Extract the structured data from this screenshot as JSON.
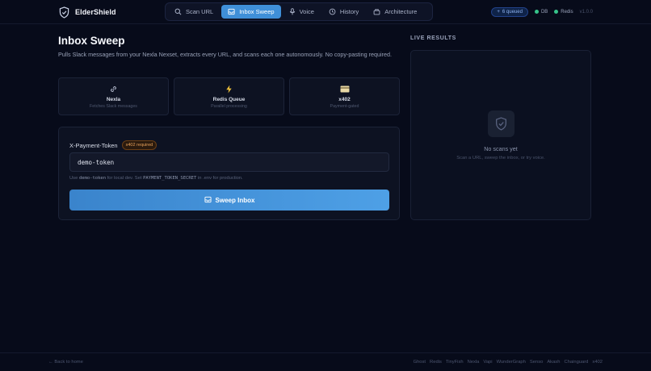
{
  "app": {
    "name": "ElderShield",
    "version": "v1.0.0"
  },
  "nav": {
    "items": [
      {
        "label": "Scan URL",
        "icon": "search-icon"
      },
      {
        "label": "Inbox Sweep",
        "icon": "inbox-icon",
        "active": true
      },
      {
        "label": "Voice",
        "icon": "microphone-icon"
      },
      {
        "label": "History",
        "icon": "clock-icon"
      },
      {
        "label": "Architecture",
        "icon": "stack-icon"
      }
    ]
  },
  "status": {
    "queued": "6 queued",
    "db": "DB",
    "redis": "Redis",
    "dot_color": "#36c48a"
  },
  "main": {
    "title": "Inbox Sweep",
    "description": "Pulls Slack messages from your Nexla Nexset, extracts every URL, and scans each one autonomously. No copy-pasting required."
  },
  "features": [
    {
      "title": "Nexla",
      "subtitle": "Fetches Slack messages",
      "icon": "link-icon"
    },
    {
      "title": "Redis Queue",
      "subtitle": "Parallel processing",
      "icon": "lightning-icon"
    },
    {
      "title": "x402",
      "subtitle": "Payment-gated",
      "icon": "credit-card-icon"
    }
  ],
  "form": {
    "token_label": "X-Payment-Token",
    "token_badge": "x402 required",
    "token_value": "demo-token",
    "hint_prefix": "Use",
    "hint_code_1": "demo-token",
    "hint_middle": "for local dev. Set",
    "hint_code_2": "PAYMENT_TOKEN_SECRET",
    "hint_suffix": "in .env for production.",
    "button_label": "Sweep Inbox"
  },
  "results": {
    "heading": "LIVE RESULTS",
    "empty_title": "No scans yet",
    "empty_subtitle": "Scan a URL, sweep the inbox, or try voice."
  },
  "footer": {
    "back_label": "← Back to home",
    "links": [
      "Ghost",
      "Redis",
      "TinyFish",
      "Nexla",
      "Vapi",
      "WunderGraph",
      "Senso",
      "Akash",
      "Chainguard",
      "x402"
    ]
  },
  "colors": {
    "accent": "#3f8fd8",
    "background": "#070b1a",
    "card": "#0d1222",
    "badge_orange": "#e8a25a"
  }
}
